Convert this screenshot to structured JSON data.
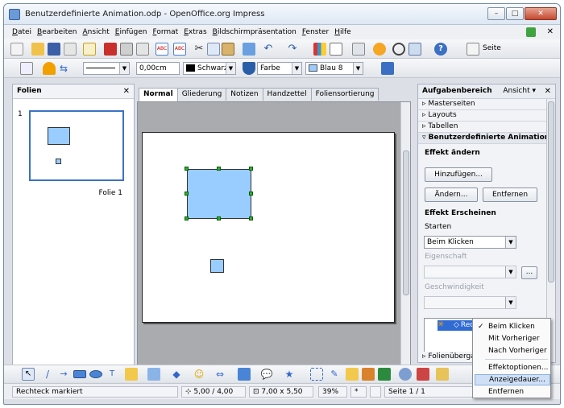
{
  "window": {
    "title": "Benutzerdefinierte Animation.odp - OpenOffice.org Impress"
  },
  "menu": [
    "Datei",
    "Bearbeiten",
    "Ansicht",
    "Einfügen",
    "Format",
    "Extras",
    "Bildschirmpräsentation",
    "Fenster",
    "Hilfe"
  ],
  "toolbar1": {
    "page_button_label": "Seite"
  },
  "toolbar2": {
    "line_width": "0,00cm",
    "line_color": "Schwarz",
    "area_style": "Farbe",
    "area_color": "Blau 8"
  },
  "slides_panel": {
    "title": "Folien",
    "slide_number": "1",
    "slide_label": "Folie 1"
  },
  "view_tabs": [
    "Normal",
    "Gliederung",
    "Notizen",
    "Handzettel",
    "Foliensortierung"
  ],
  "task_pane": {
    "title": "Aufgabenbereich",
    "view_label": "Ansicht",
    "sections": [
      "Masterseiten",
      "Layouts",
      "Tabellen"
    ],
    "open_section": "Benutzerdefinierte Animation",
    "change_effect_title": "Effekt ändern",
    "add_button": "Hinzufügen...",
    "change_button": "Ändern...",
    "remove_button": "Entfernen",
    "effect_title": "Effekt Erscheinen",
    "start_label": "Starten",
    "start_value": "Beim Klicken",
    "property_label": "Eigenschaft",
    "speed_label": "Geschwindigkeit",
    "effect_list_item": "Rechteck",
    "collapsed_section": "Folienübergang"
  },
  "context_menu": {
    "items": [
      "Beim Klicken",
      "Mit Vorheriger",
      "Nach Vorheriger",
      "Effektoptionen...",
      "Anzeigedauer...",
      "Entfernen"
    ],
    "checked_item": "Beim Klicken",
    "highlighted_item": "Anzeigedauer..."
  },
  "statusbar": {
    "message": "Rechteck markiert",
    "position": "5,00 / 4,00",
    "size": "7,00 x 5,50",
    "zoom": "39%",
    "modified": "*",
    "page": "Seite 1 / 1"
  },
  "colors": {
    "shape_fill": "#99ccff",
    "selection_handle": "#2db32d",
    "highlight": "#2f6bd3"
  }
}
